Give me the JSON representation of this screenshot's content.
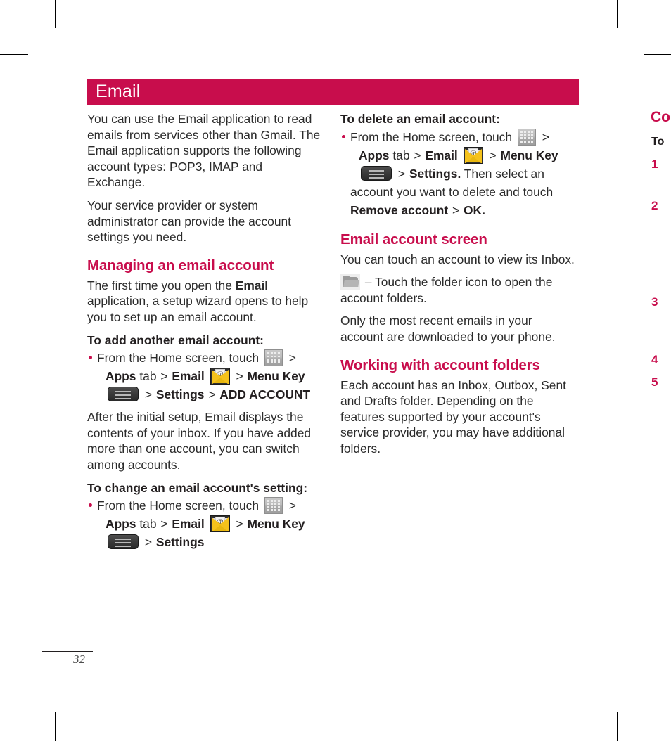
{
  "document": {
    "page_number": "32",
    "accent_color": "#c80d4c",
    "text_color": "#2b2b2b"
  },
  "banner": {
    "title": "Email"
  },
  "left_column": {
    "intro_1": "You can use the Email application to read emails from services other than Gmail. The Email application supports the following account types: POP3, IMAP and Exchange.",
    "intro_2": "Your service provider or system administrator can provide the account settings you need.",
    "heading_managing": "Managing an email account",
    "managing_body_a": "The first time you open the ",
    "managing_body_email": "Email",
    "managing_body_b": " application, a setup wizard opens to help you to set up an email account.",
    "subheading_add": "To add another email account:",
    "add_steps": {
      "from_home": "From the Home screen, touch",
      "gt": ">",
      "apps": "Apps",
      "tab": "tab",
      "email": "Email",
      "menu_key": "Menu Key",
      "settings": "Settings",
      "add_account": "ADD ACCOUNT"
    },
    "after_setup": "After the initial setup, Email displays the contents of your inbox. If you have added more than one account, you can switch among accounts.",
    "subheading_change": "To change an email account's setting:",
    "change_steps": {
      "from_home": "From the Home screen, touch",
      "gt": ">",
      "apps": "Apps",
      "tab": "tab",
      "email": "Email",
      "menu_key": "Menu Key",
      "settings": "Settings"
    }
  },
  "right_column": {
    "subheading_delete": "To delete an email account:",
    "delete_steps": {
      "from_home": "From the Home screen, touch",
      "gt": ">",
      "apps": "Apps",
      "tab": "tab",
      "email": "Email",
      "menu_key": "Menu Key",
      "settings": "Settings.",
      "then_select": " Then select an account you want to delete and touch ",
      "remove_account": "Remove account",
      "ok": "OK."
    },
    "heading_account_screen": "Email account screen",
    "account_screen_body_1": "You can touch an account to view its Inbox.",
    "folder_line": " – Touch the folder icon to open the account folders.",
    "account_screen_body_2": "Only the most recent emails in your account are downloaded to your phone.",
    "heading_working": "Working with account folders",
    "working_body": "Each account has an Inbox, Outbox, Sent and Drafts folder. Depending on the features supported by your account's service provider, you may have additional folders."
  },
  "next_page_bleed": {
    "heading": "Co",
    "subheading": "To",
    "numbers": [
      "1",
      "2",
      "3",
      "4",
      "5"
    ]
  },
  "icons": {
    "apps_grid": "apps-grid-icon",
    "email_envelope": "email-envelope-icon",
    "menu_key": "menu-key-icon",
    "folder": "folder-icon"
  }
}
